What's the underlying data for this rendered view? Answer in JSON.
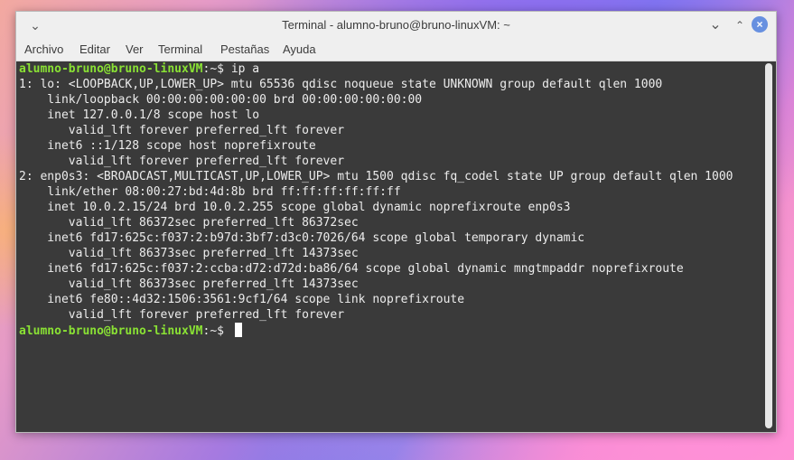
{
  "window": {
    "title": "Terminal - alumno-bruno@bruno-linuxVM: ~"
  },
  "menu": [
    "Archivo",
    "Editar",
    "Ver",
    "Terminal",
    "Pestañas",
    "Ayuda"
  ],
  "prompt": {
    "user_host": "alumno-bruno@bruno-linuxVM",
    "path_sep": ":~$ "
  },
  "command": "ip a",
  "output": [
    "1: lo: <LOOPBACK,UP,LOWER_UP> mtu 65536 qdisc noqueue state UNKNOWN group default qlen 1000",
    "    link/loopback 00:00:00:00:00:00 brd 00:00:00:00:00:00",
    "    inet 127.0.0.1/8 scope host lo",
    "       valid_lft forever preferred_lft forever",
    "    inet6 ::1/128 scope host noprefixroute",
    "       valid_lft forever preferred_lft forever",
    "2: enp0s3: <BROADCAST,MULTICAST,UP,LOWER_UP> mtu 1500 qdisc fq_codel state UP group default qlen 1000",
    "    link/ether 08:00:27:bd:4d:8b brd ff:ff:ff:ff:ff:ff",
    "    inet 10.0.2.15/24 brd 10.0.2.255 scope global dynamic noprefixroute enp0s3",
    "       valid_lft 86372sec preferred_lft 86372sec",
    "    inet6 fd17:625c:f037:2:b97d:3bf7:d3c0:7026/64 scope global temporary dynamic",
    "       valid_lft 86373sec preferred_lft 14373sec",
    "    inet6 fd17:625c:f037:2:ccba:d72:d72d:ba86/64 scope global dynamic mngtmpaddr noprefixroute",
    "       valid_lft 86373sec preferred_lft 14373sec",
    "    inet6 fe80::4d32:1506:3561:9cf1/64 scope link noprefixroute",
    "       valid_lft forever preferred_lft forever"
  ],
  "colors": {
    "prompt": "#8ae234",
    "terminal_bg": "#3a3a3a",
    "close_button": "#6790e0"
  }
}
